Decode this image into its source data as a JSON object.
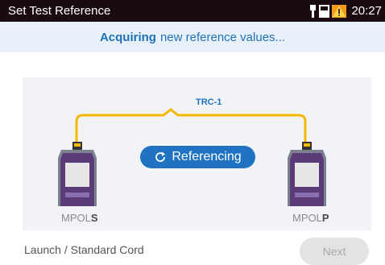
{
  "statusbar": {
    "title": "Set Test Reference",
    "time": "20:27",
    "icons": [
      "probe-icon",
      "battery-icon",
      "warning-icon"
    ]
  },
  "banner": {
    "bold": "Acquiring",
    "text": "new reference values..."
  },
  "diagram": {
    "cable_label": "TRC-1",
    "status_label": "Referencing",
    "left_device": {
      "prefix": "MPOL",
      "suffix": "S"
    },
    "right_device": {
      "prefix": "MPOL",
      "suffix": "P"
    }
  },
  "footer": {
    "left_text": "Launch / Standard Cord",
    "next_label": "Next"
  },
  "colors": {
    "status_bg": "#1a0b12",
    "accent_blue": "#1f73c0",
    "fiber_yellow": "#f5b800",
    "device_purple": "#5b3a78",
    "warning_orange": "#f39a1e"
  }
}
